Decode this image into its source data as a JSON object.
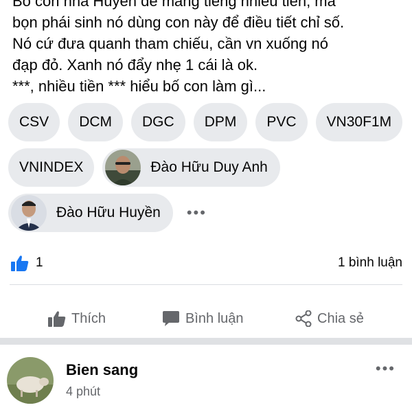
{
  "post": {
    "lines": [
      "Bố con nhà Huyền đè mảng tiếng nhiều tiền, mà",
      "bọn phái sinh nó dùng con này để điều tiết chỉ số.",
      "Nó cứ đưa quanh tham chiếu, cần vn xuống nó",
      "đạp đỏ. Xanh nó đẩy nhẹ 1 cái là ok.",
      "***, nhiều tiền *** hiểu bố con làm gì..."
    ]
  },
  "tags": {
    "row1": [
      "CSV",
      "DCM",
      "DGC",
      "DPM",
      "PVC",
      "VN30F1M"
    ],
    "vnindex": "VNINDEX",
    "person1": "Đào Hữu Duy Anh",
    "person2": "Đào Hữu Huyền",
    "more": "•••"
  },
  "reactions": {
    "like_count": "1",
    "comment_count": "1 bình luận"
  },
  "actions": {
    "like": "Thích",
    "comment": "Bình luận",
    "share": "Chia sẻ"
  },
  "comment": {
    "author": "Bien sang",
    "time": "4 phút",
    "more": "•••"
  },
  "colors": {
    "like_blue": "#1877f2",
    "chip_bg": "#e8eaed",
    "secondary_text": "#65676b"
  }
}
